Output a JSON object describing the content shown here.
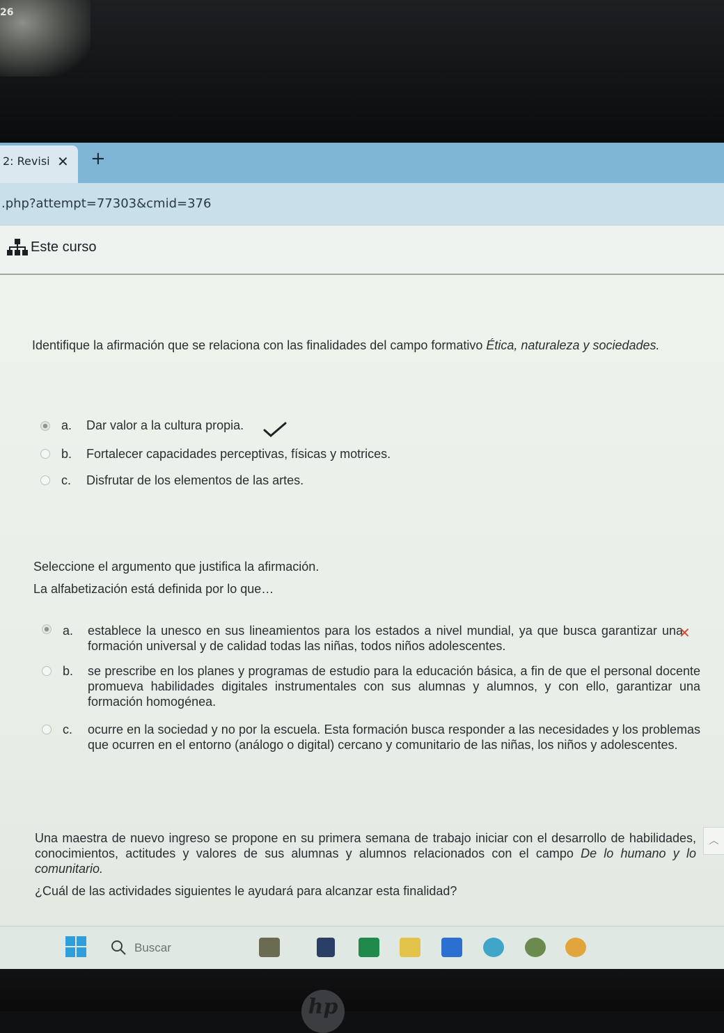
{
  "corner_text": "26",
  "tab": {
    "title": "2: Revisi",
    "close": "✕",
    "new_tab": "+"
  },
  "url": {
    "text": ".php?attempt=77303&cmid=376"
  },
  "course": {
    "label": "Este curso"
  },
  "question1": {
    "text_plain": "Identifique la afirmación que se relaciona con las finalidades del campo formativo",
    "text_italic": "Ética, naturaleza y sociedades.",
    "options": [
      {
        "letter": "a.",
        "text": "Dar valor a la cultura propia.",
        "selected": true,
        "feedback": "correct"
      },
      {
        "letter": "b.",
        "text": "Fortalecer capacidades perceptivas, físicas y motrices.",
        "selected": false
      },
      {
        "letter": "c.",
        "text": "Disfrutar de los elementos de las artes.",
        "selected": false
      }
    ]
  },
  "question2": {
    "prompt": "Seleccione el argumento que justifica la afirmación.",
    "statement": "La alfabetización está definida por lo que…",
    "options": [
      {
        "letter": "a.",
        "text": "establece la unesco en sus lineamientos para los estados a nivel mundial, ya que busca garantizar una formación universal y de calidad todas las niñas, todos niños adolescentes.",
        "selected": true,
        "feedback": "incorrect"
      },
      {
        "letter": "b.",
        "text": "se prescribe en los planes y programas de estudio para la educación básica, a fin de que el personal docente promueva habilidades digitales instrumentales con sus alumnas y alumnos, y con ello, garantizar una formación homogénea.",
        "selected": false
      },
      {
        "letter": "c.",
        "text": "ocurre en la sociedad y no por la escuela. Esta formación busca responder a las necesidades y los problemas que ocurren en el entorno (análogo o digital) cercano y comunitario de las niñas, los niños y adolescentes.",
        "selected": false
      }
    ]
  },
  "question3": {
    "text_plain": "Una maestra de nuevo ingreso se propone en su primera semana de trabajo iniciar con el desarrollo de habilidades, conocimientos, actitudes y valores de sus alumnas y alumnos relacionados con el campo",
    "text_italic": "De lo humano y lo comunitario.",
    "question": "¿Cuál de las actividades siguientes le ayudará para alcanzar esta finalidad?"
  },
  "taskbar": {
    "search_placeholder": "Buscar",
    "icons": [
      "start-icon",
      "widgets-icon",
      "explorer-icon",
      "excel-icon",
      "files-icon",
      "word-icon",
      "edge-icon",
      "app-icon",
      "chrome-icon"
    ]
  },
  "bezel": {
    "logo": "hp"
  },
  "colors": {
    "tab_bar": "#7fb6d6",
    "url_bar": "#c8e0ea",
    "page_bg": "#eef3ec",
    "wrong_mark": "#d04a3a"
  }
}
